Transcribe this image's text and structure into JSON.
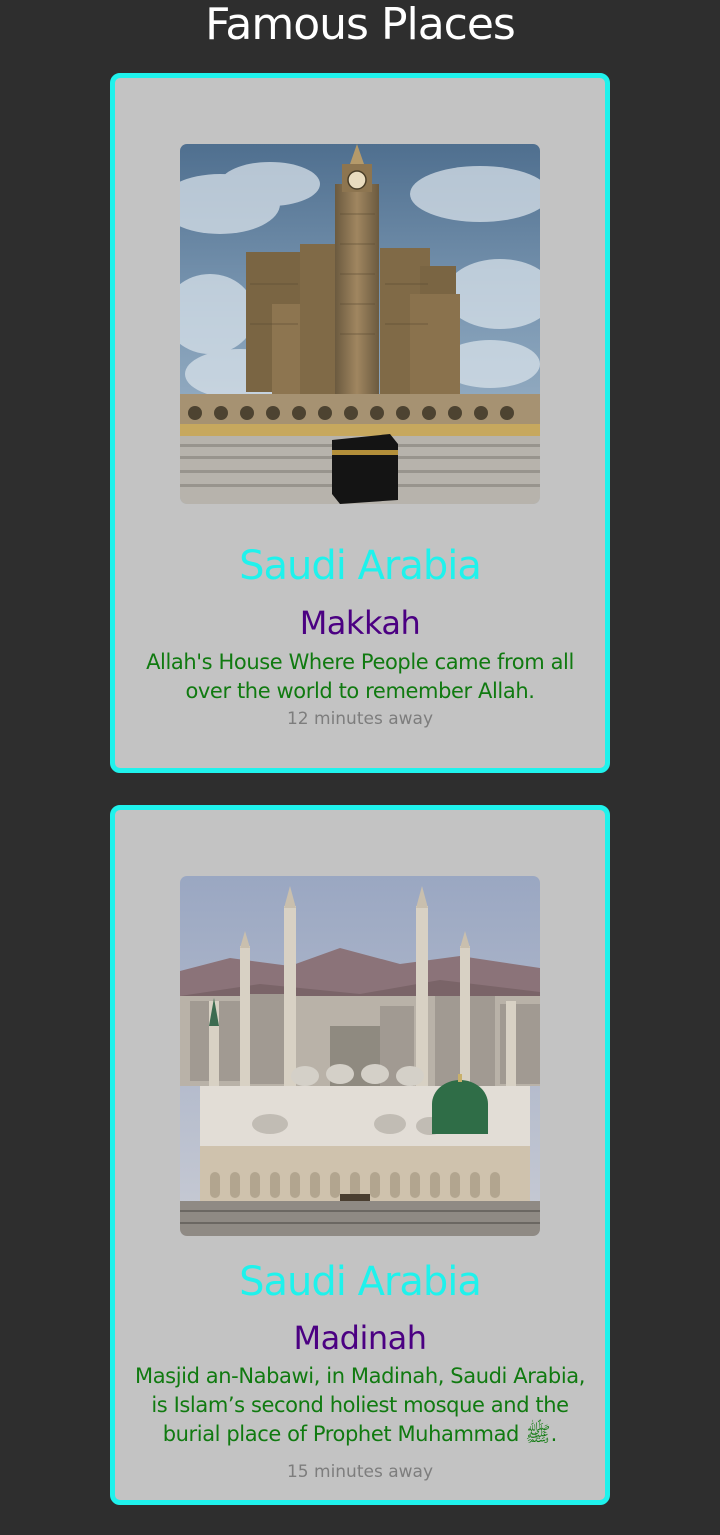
{
  "page": {
    "title": "Famous Places"
  },
  "theme": {
    "background": "#2e2e2e",
    "card_background": "#c3c3c3",
    "card_border": "#1ff2ec",
    "country_color": "#1ff2ec",
    "city_color": "#4b0082",
    "description_color": "#107a10",
    "time_color": "#7d7d7d"
  },
  "cards": [
    {
      "image_icon": "makkah-clock-tower-kaaba-photo",
      "country": "Saudi Arabia",
      "city": "Makkah",
      "description": "Allah's House Where People came from all over the world to remember Allah.",
      "time": "12 minutes away"
    },
    {
      "image_icon": "masjid-an-nabawi-green-dome-photo",
      "country": "Saudi Arabia",
      "city": "Madinah",
      "description": "Masjid an-Nabawi, in Madinah, Saudi Arabia, is Islam’s second holiest mosque and the burial place of Prophet Muhammad ﷺ.",
      "time": "15 minutes away"
    }
  ]
}
